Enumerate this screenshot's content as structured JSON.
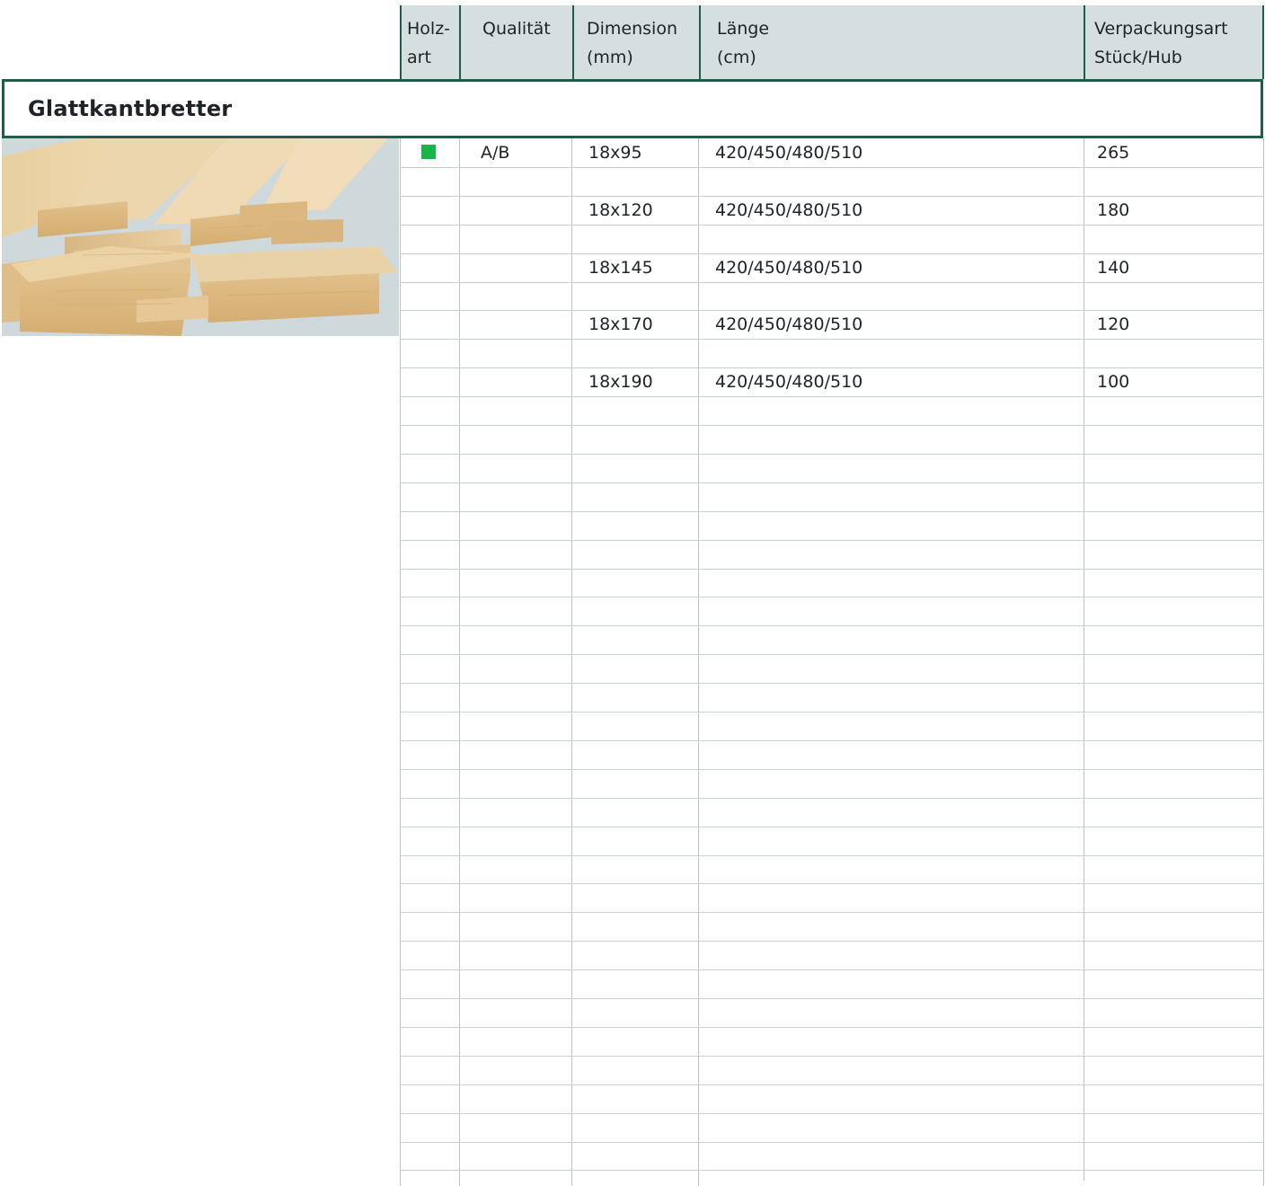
{
  "table": {
    "headers": {
      "holzart": "Holz-\nart",
      "qualitaet": "Qualität",
      "dimension": "Dimension\n(mm)",
      "laenge": "Länge\n(cm)",
      "verpackung": "Verpackungsart\nStück/Hub"
    },
    "section_title": "Glattkantbretter",
    "rows": [
      {
        "qualitaet": "A/B",
        "dimension": "18x95",
        "laenge": "420/450/480/510",
        "verpackung": "265"
      },
      {
        "qualitaet": "",
        "dimension": "18x120",
        "laenge": "420/450/480/510",
        "verpackung": "180"
      },
      {
        "qualitaet": "",
        "dimension": "18x145",
        "laenge": "420/450/480/510",
        "verpackung": "140"
      },
      {
        "qualitaet": "",
        "dimension": "18x170",
        "laenge": "420/450/480/510",
        "verpackung": "120"
      },
      {
        "qualitaet": "",
        "dimension": "18x190",
        "laenge": "420/450/480/510",
        "verpackung": "100"
      }
    ]
  },
  "colors": {
    "accent": "#1f5d48",
    "header_bg": "#d5dfdf",
    "marker": "#18b54a"
  },
  "icons": {
    "holzart_marker": "green-square-icon",
    "product_photo": "wood-planks-photo"
  }
}
